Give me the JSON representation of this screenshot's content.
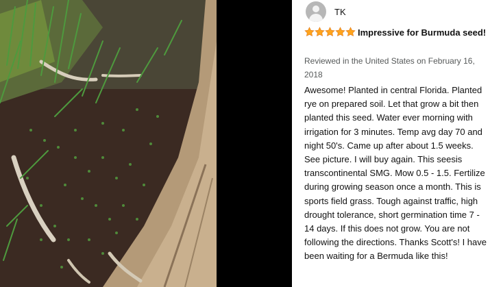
{
  "review": {
    "author_name": "TK",
    "rating_stars": 5,
    "star_color": "#ffa41c",
    "title": "Impressive for Burmuda seed!",
    "meta": "Reviewed in the United States on February 16, 2018",
    "body": "Awesome! Planted in central Florida. Planted rye on prepared soil. Let that grow a bit then planted this seed. Water ever morning with irrigation for 3 minutes. Temp avg day 70 and night 50's. Came up after about 1.5 weeks. See picture. I will buy again. This seesis transcontinental SMG. Mow 0.5 - 1.5. Fertilize during growing season once a month. This is sports field grass. Tough against traffic, high drought tolerance, short germination time 7 - 14 days. If this does not grow. You are not following the directions. Thanks Scott's! I have been waiting for a Bermuda like this!"
  },
  "icons": {
    "avatar": "default-user-avatar-icon",
    "star": "star-icon"
  }
}
